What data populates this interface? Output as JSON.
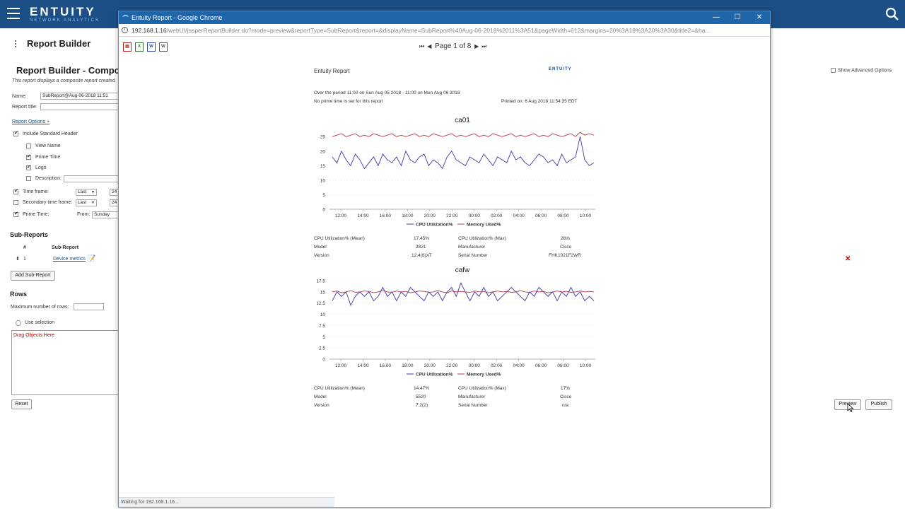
{
  "app": {
    "brand": "ENTUITY",
    "tagline": "NETWORK ANALYTICS"
  },
  "left": {
    "title": "Report Builder",
    "heading": "Report Builder - Compo",
    "description": "This report displays a composite report created",
    "name_label": "Name:",
    "name_value": "SubReport@Aug-06-2018 11:51",
    "report_title_label": "Report title:",
    "report_options": "Report Options +",
    "include_header": "Include Standard Header",
    "view_name": "View Name",
    "prime_time": "Prime Time",
    "logo": "Logo",
    "description_label": "Description:",
    "time_frame": "Time frame:",
    "time_frame_sel": "Last",
    "time_frame_val": "24",
    "secondary_time_frame": "Secondary time frame:",
    "secondary_sel": "Last",
    "secondary_val": "24",
    "prime_time_label": "Prime Time:",
    "from_label": "From:",
    "from_value": "Sunday",
    "subreports_heading": "Sub-Reports",
    "col_num": "#",
    "col_subreport": "Sub-Report",
    "row_num": "1",
    "row_name": "Device metrics",
    "add_subreport": "Add Sub-Report",
    "rows_heading": "Rows",
    "max_rows_label": "Maximum number of rows:",
    "use_selection": "Use selection",
    "drag_objects": "Drag Objects Here",
    "reset": "Reset"
  },
  "right": {
    "show_advanced": "Show Advanced Options",
    "preview": "Preview",
    "publish": "Publish"
  },
  "window": {
    "title": "Entuity Report - Google Chrome",
    "url_host": "192.168.1.16",
    "url_path": "/webUI/jasperReportBuilder.do?mode=preview&reportType=SubReport&report=&displayName=SubReport%40Aug-06-2018%2011%3A51&pageWidth=612&margins=20%3A18%3A20%3A30&title2=&ha...",
    "page_label": "Page 1 of 8",
    "status": "Waiting for 192.168.1.16..."
  },
  "report": {
    "title": "Entuity Report",
    "logo_text": "ENTUITY",
    "period": "Over the period 11:00 on Sun Aug 05 2018 - 11:00 on Mon Aug 06 2018",
    "prime_note": "No prime time is set for this report",
    "printed": "Printed on: 6 Aug 2018 11:54:35 EDT",
    "devices": [
      {
        "name": "ca01",
        "stats": {
          "cpu_mean_label": "CPU Utilization% (Mean)",
          "cpu_mean": "17.45%",
          "cpu_max_label": "CPU Utilization% (Max)",
          "cpu_max": "26%",
          "model_label": "Model",
          "model": "2821",
          "manufacturer_label": "Manufacturer",
          "manufacturer": "Cisco",
          "version_label": "Version",
          "version": "12.4(6)XT",
          "serial_label": "Serial Number",
          "serial": "FHK1021F2WR"
        }
      },
      {
        "name": "cafw",
        "stats": {
          "cpu_mean_label": "CPU Utilization% (Mean)",
          "cpu_mean": "14.47%",
          "cpu_max_label": "CPU Utilization% (Max)",
          "cpu_max": "17%",
          "model_label": "Model",
          "model": "5520",
          "manufacturer_label": "Manufacturer",
          "manufacturer": "Cisco",
          "version_label": "Version",
          "version": "7.2(2)",
          "serial_label": "Serial Number",
          "serial": "n/a"
        }
      }
    ]
  },
  "chart_data": [
    {
      "type": "line",
      "title": "ca01",
      "xlabel": "",
      "ylabel": "",
      "x": [
        "12:00",
        "14:00",
        "16:00",
        "18:00",
        "20:00",
        "22:00",
        "00:00",
        "02:00",
        "04:00",
        "06:00",
        "08:00",
        "10:00"
      ],
      "ylim": [
        0,
        27
      ],
      "yticks": [
        0,
        5,
        10,
        15,
        20,
        25
      ],
      "legend": "bottom",
      "series": [
        {
          "name": "CPU Utilization%",
          "color": "#3b3ba8",
          "values": [
            18,
            16,
            20,
            17,
            15,
            19,
            17,
            14,
            16,
            18,
            15,
            19,
            17,
            16,
            18,
            15,
            20,
            17,
            16,
            18,
            19,
            15,
            17,
            16,
            14,
            18,
            20,
            17,
            16,
            15,
            18,
            17,
            16,
            19,
            17,
            15,
            18,
            17,
            16,
            20,
            17,
            18,
            16,
            15,
            17,
            19,
            18,
            16,
            17,
            15,
            19,
            16,
            17,
            18,
            25,
            17,
            15,
            16
          ]
        },
        {
          "name": "Memory Used%",
          "color": "#b23a4a",
          "values": [
            25,
            25.5,
            26,
            25,
            25.5,
            26,
            25,
            25.5,
            25,
            26,
            25.5,
            25,
            25.5,
            26,
            25,
            25.5,
            25,
            25.5,
            26,
            25,
            25.5,
            25,
            26,
            25.5,
            25,
            25.5,
            26,
            25,
            25.5,
            25,
            25.5,
            26,
            25,
            25.5,
            25,
            26,
            25.5,
            25,
            25.5,
            26,
            25,
            25.5,
            25,
            25.5,
            26,
            25,
            25.5,
            25,
            26,
            25.5,
            25,
            25.5,
            26,
            25,
            26.5,
            25.5,
            26,
            25.5
          ]
        }
      ]
    },
    {
      "type": "line",
      "title": "cafw",
      "xlabel": "",
      "ylabel": "",
      "x": [
        "12:00",
        "14:00",
        "16:00",
        "18:00",
        "20:00",
        "22:00",
        "00:00",
        "02:00",
        "04:00",
        "06:00",
        "08:00",
        "10:00"
      ],
      "ylim": [
        0,
        17.5
      ],
      "yticks": [
        0,
        2.5,
        5,
        7.5,
        10,
        12.5,
        15,
        17.5
      ],
      "legend": "bottom",
      "series": [
        {
          "name": "CPU Utilization%",
          "color": "#3b3ba8",
          "values": [
            13,
            15,
            14,
            15,
            12,
            14,
            15,
            14,
            15,
            13,
            14,
            16,
            14,
            15,
            13,
            15,
            14,
            16,
            15,
            14,
            13,
            15,
            14,
            15,
            13,
            15,
            16,
            14,
            17,
            15,
            13,
            15,
            14,
            16,
            14,
            15,
            13,
            14,
            15,
            16,
            15,
            14,
            13,
            15,
            14,
            16,
            15,
            14,
            15,
            13,
            15,
            14,
            16,
            14,
            15,
            13,
            14,
            13
          ]
        },
        {
          "name": "Memory Used%",
          "color": "#b23a4a",
          "values": [
            15,
            15.2,
            14.8,
            15,
            15.3,
            14.9,
            15,
            15.2,
            15.1,
            14.8,
            15,
            15.3,
            15,
            14.9,
            15.2,
            15,
            15.1,
            14.8,
            15,
            15.2,
            15.1,
            14.9,
            15,
            15.3,
            15,
            14.8,
            15.2,
            15,
            15.1,
            15,
            14.9,
            15.2,
            15,
            15.1,
            14.8,
            15,
            15.2,
            15,
            15.1,
            14.9,
            15,
            15.3,
            15,
            14.9,
            15.2,
            15,
            15.1,
            14.8,
            15,
            15.2,
            15,
            15.1,
            14.9,
            15,
            15.2,
            15,
            15.1,
            15
          ]
        }
      ]
    }
  ]
}
